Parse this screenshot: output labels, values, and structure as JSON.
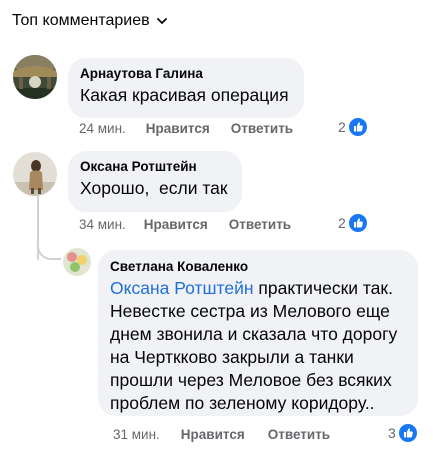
{
  "header": {
    "sort_label": "Топ комментариев"
  },
  "comments": [
    {
      "author": "Арнаутова Галина",
      "text": "Какая красивая операция",
      "time": "24 мин.",
      "like_label": "Нравится",
      "reply_label": "Ответить",
      "reaction_count": "2"
    },
    {
      "author": "Оксана Ротштейн",
      "text": "Хорошо,  если так",
      "time": "34 мин.",
      "like_label": "Нравится",
      "reply_label": "Ответить",
      "reaction_count": "2"
    }
  ],
  "reply": {
    "author": "Светлана Коваленко",
    "mention": "Оксана Ротштейн",
    "text_line1_rest": " практически так.",
    "lines": [
      "Невестке сестра из Мелового еще",
      "днем звонила и сказала что дорогу",
      "на Черткково закрыли а танки",
      "прошли через Меловое без всяких",
      "проблем по зеленому коридору.."
    ],
    "time": "31 мин.",
    "like_label": "Нравится",
    "reply_label": "Ответить",
    "reaction_count": "3"
  },
  "colors": {
    "like_blue": "#1877f2",
    "mention_blue": "#216fdb",
    "bubble": "#f0f2f5",
    "meta_gray": "#65676b"
  }
}
